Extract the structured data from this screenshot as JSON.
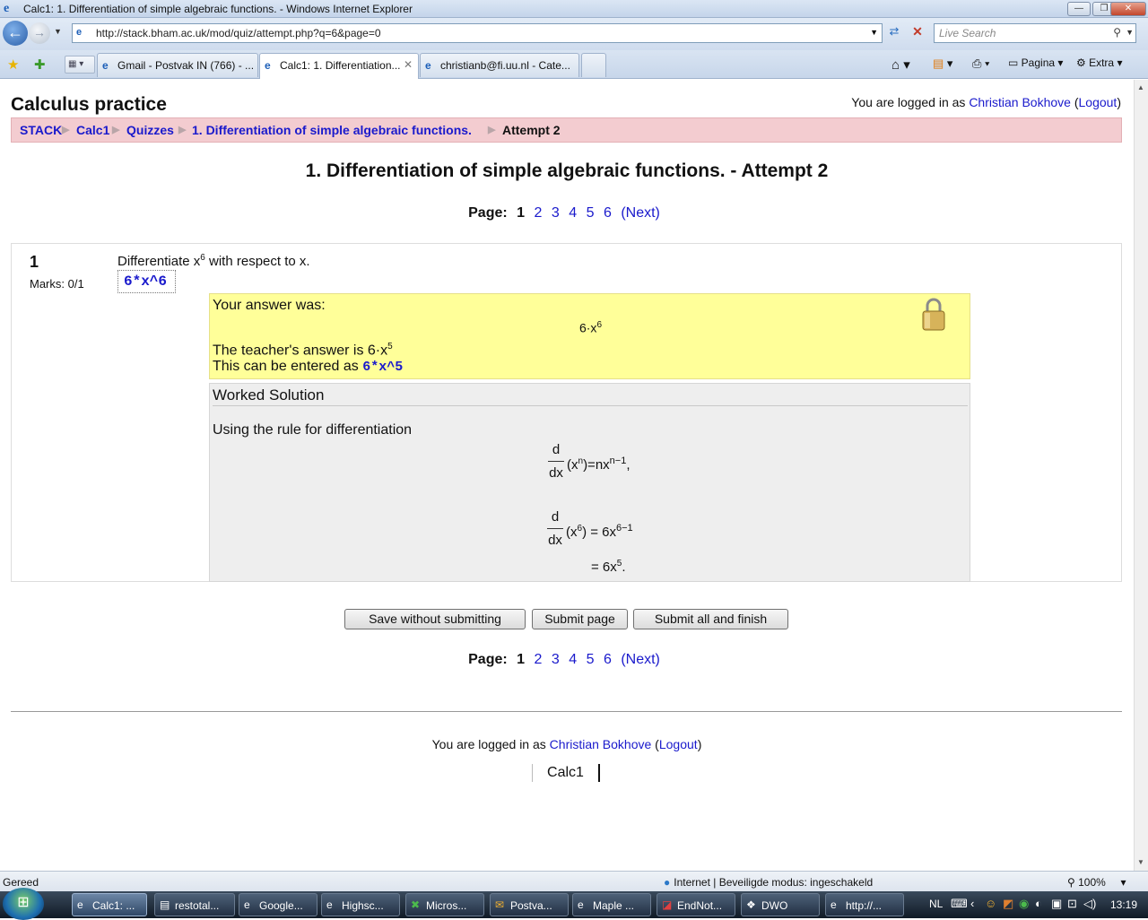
{
  "window": {
    "title": "Calc1: 1. Differentiation of simple algebraic functions. - Windows Internet Explorer"
  },
  "toolbar": {
    "url": "http://stack.bham.ac.uk/mod/quiz/attempt.php?q=6&page=0",
    "search_placeholder": "Live Search",
    "tabs": [
      {
        "label": "Gmail - Postvak IN (766) - ...",
        "active": false
      },
      {
        "label": "Calc1: 1. Differentiation...",
        "active": true
      },
      {
        "label": "christianb@fi.uu.nl - Cate...",
        "active": false
      }
    ],
    "commands": {
      "page": "Pagina",
      "extra": "Extra"
    }
  },
  "page": {
    "site_title": "Calculus practice",
    "login_prefix": "You are logged in as",
    "user_name": "Christian Bokhove",
    "logout_label": "Logout",
    "breadcrumbs": [
      "STACK",
      "Calc1",
      "Quizzes",
      "1. Differentiation of simple algebraic functions."
    ],
    "breadcrumb_current": "Attempt 2",
    "quiz_heading": "1. Differentiation of simple algebraic functions. - Attempt 2",
    "pager": {
      "label": "Page:",
      "current": "1",
      "pages": [
        "2",
        "3",
        "4",
        "5",
        "6"
      ],
      "next": "(Next)"
    },
    "question": {
      "number": "1",
      "marks": "Marks: 0/1",
      "text_prefix": "Differentiate x",
      "text_exp": "6",
      "text_suffix": " with respect to x.",
      "input_value": "6*x^6",
      "feedback_label": "Your answer was:",
      "your_answer_base": "6·x",
      "your_answer_exp": "6",
      "teacher_prefix": "The teacher's answer is 6·x",
      "teacher_exp": "5",
      "enter_prefix": "This can be entered as ",
      "enter_code": "6*x^5",
      "worked_title": "Worked Solution",
      "worked_text": "Using the rule for differentiation",
      "math": {
        "d": "d",
        "dx": "dx",
        "rule_lhs": "(x",
        "rule_n": "n",
        "rule_mid": ")=nx",
        "rule_exp": "n−1",
        "rule_end": ",",
        "step_lhs": "(x",
        "step_6": "6",
        "step_mid": ") = 6x",
        "step_exp": "6−1",
        "step2_prefix": "= 6x",
        "step2_exp": "5",
        "step2_end": "."
      }
    },
    "buttons": {
      "save": "Save without submitting",
      "submit_page": "Submit page",
      "submit_all": "Submit all and finish"
    },
    "footer_course": "Calc1"
  },
  "statusbar": {
    "left": "Gereed",
    "zone": "Internet | Beveiligde modus: ingeschakeld",
    "zoom": "100%"
  },
  "taskbar": {
    "items": [
      "Calc1: ...",
      "restotal...",
      "Google...",
      "Highsc...",
      "Micros...",
      "Postva...",
      "Maple ...",
      "EndNot...",
      "DWO",
      "http://..."
    ],
    "lang": "NL",
    "clock": "13:19"
  },
  "colors": {
    "link": "#1a1acc",
    "breadcrumb_bg": "#f3ccd0",
    "feedback_bg": "#ffff99",
    "worked_bg": "#eeeeee"
  }
}
